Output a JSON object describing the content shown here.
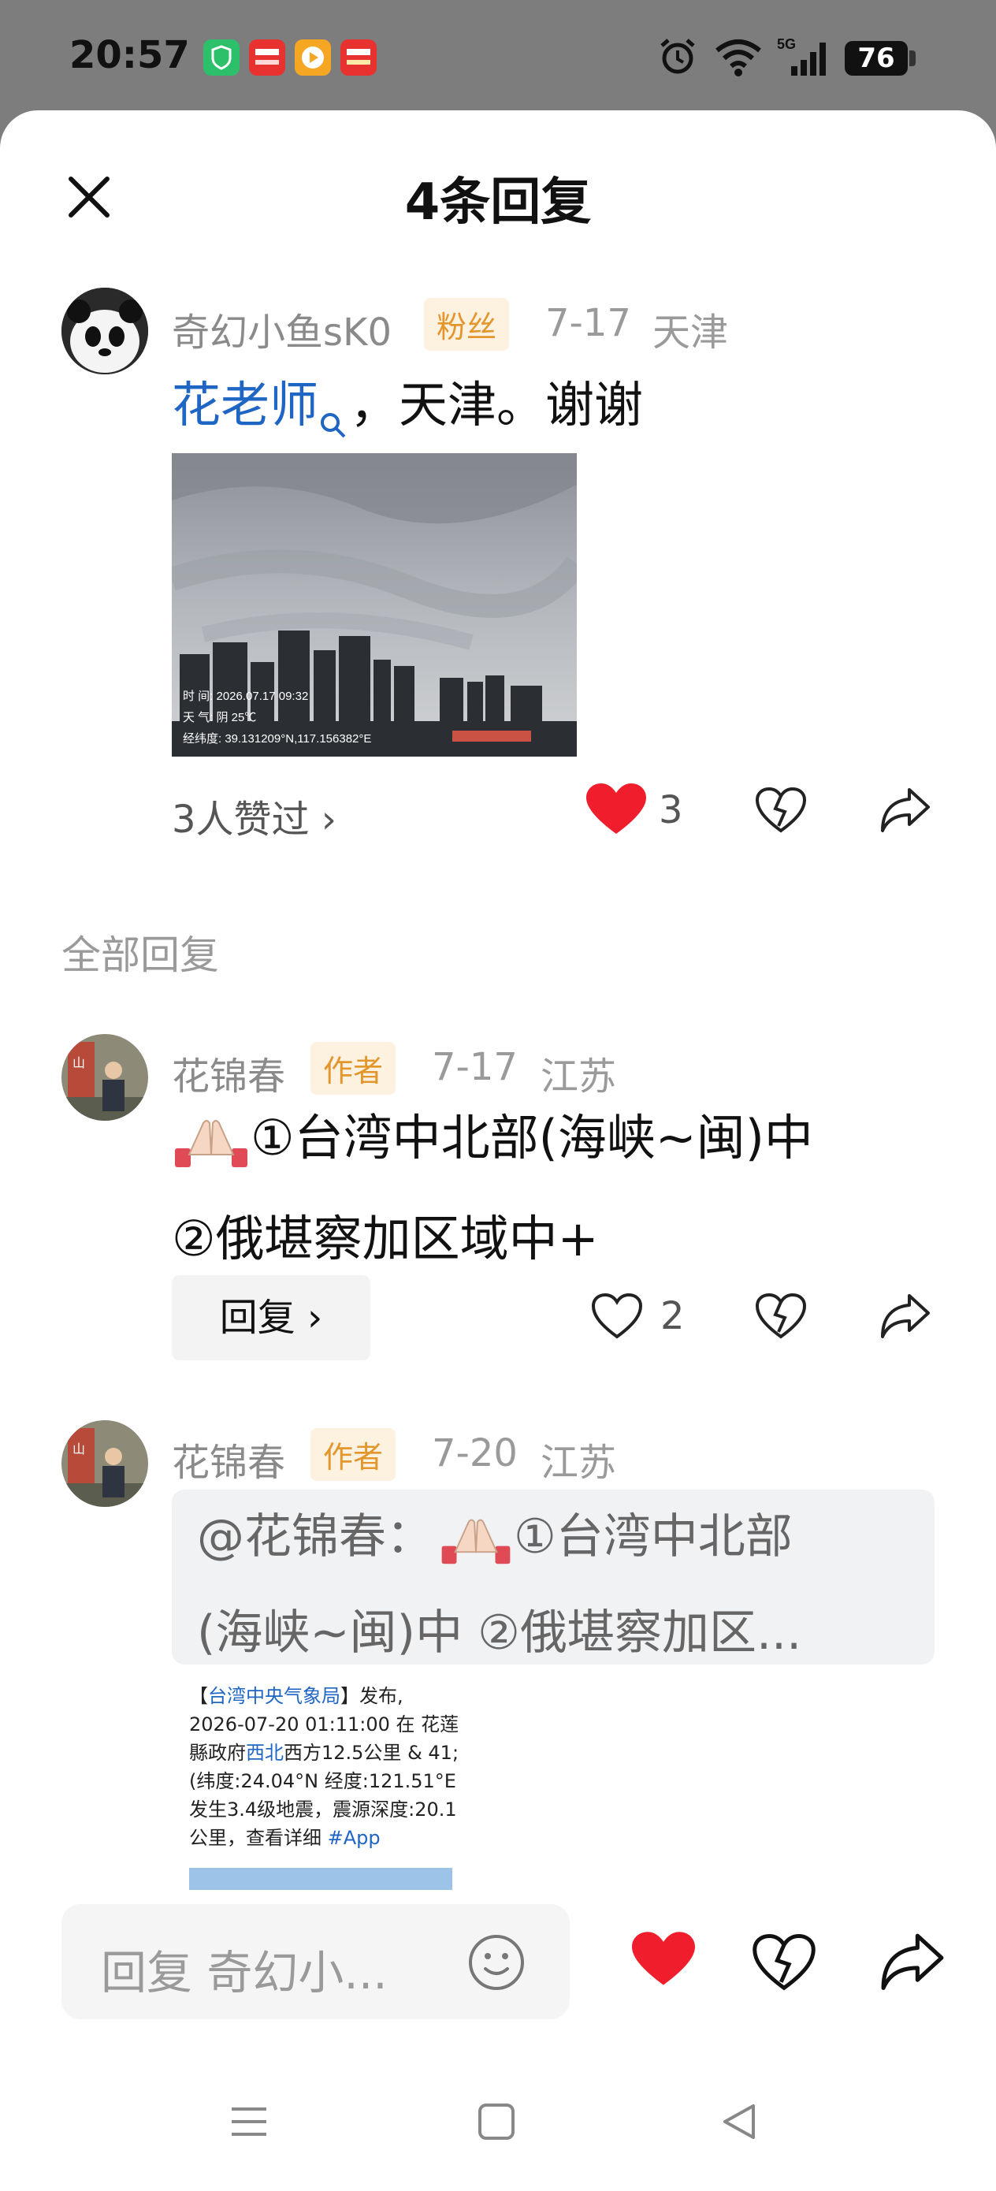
{
  "status_bar": {
    "time": "20:57",
    "app_icons": [
      "shield-icon",
      "toutiao-icon",
      "video-play-icon",
      "toutiao-lite-icon"
    ],
    "battery": "76",
    "network": "5G"
  },
  "header": {
    "title": "4条回复"
  },
  "main_comment": {
    "user": "奇幻小鱼sK0",
    "badge": "粉丝",
    "date": "7-17",
    "location": "天津",
    "mention": "花老师",
    "text": "，天津。谢谢",
    "photo_watermark": {
      "time": "时  间: 2026.07.17 09:32",
      "weather": "天  气: 阴 25℃",
      "coords": "经纬度: 39.131209°N,117.156382°E"
    },
    "likes_link": "3人赞过 ›",
    "like_count": "3"
  },
  "section_title": "全部回复",
  "replies": [
    {
      "user": "花锦春",
      "badge": "作者",
      "date": "7-17",
      "location": "江苏",
      "line1": "①台湾中北部(海峡~闽)中",
      "line2": "②俄堪察加区域中+",
      "reply_button": "回复 ›",
      "like_count": "2"
    },
    {
      "user": "花锦春",
      "badge": "作者",
      "date": "7-20",
      "location": "江苏",
      "quote_line1_prefix": "@花锦春：",
      "quote_line1_suffix": "①台湾中北部",
      "quote_line2": "(海峡~闽)中 ②俄堪察加区...",
      "image_text": {
        "l1a": "【",
        "l1b": "台湾中央气象局",
        "l1c": "】发布,",
        "l2": "2026-07-20 01:11:00 在 花莲",
        "l3a": "縣政府",
        "l3b": "西北",
        "l3c": "西方12.5公里 & 41;",
        "l4": "(纬度:24.04°N 经度:121.51°E",
        "l5": "发生3.4级地震，震源深度:20.1",
        "l6a": "公里，查看详细 ",
        "l6b": "#App"
      }
    }
  ],
  "bottom_bar": {
    "input_placeholder": "回复 奇幻小..."
  },
  "colors": {
    "accent_link": "#1f66c4",
    "heart_red": "#f01e2c",
    "badge_bg": "#fdf1e0",
    "badge_text": "#e3962b"
  }
}
